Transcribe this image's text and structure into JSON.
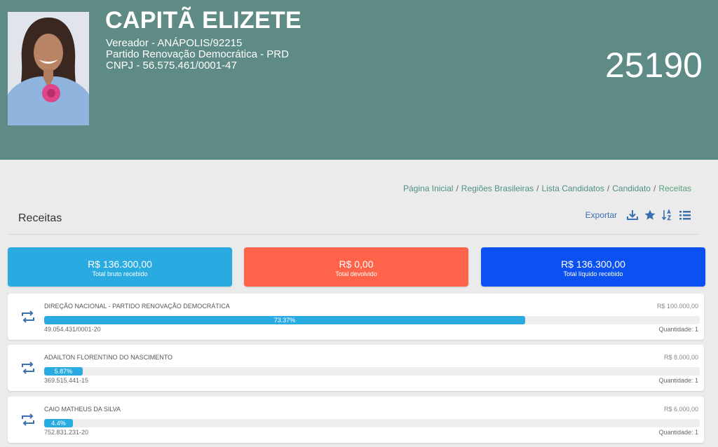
{
  "candidate": {
    "name": "CAPITÃ ELIZETE",
    "office": "Vereador - ANÁPOLIS/92215",
    "party": "Partido Renovação Democrática - PRD",
    "cnpj": "CNPJ - 56.575.461/0001-47",
    "number": "25190"
  },
  "breadcrumb": {
    "items": [
      "Página Inicial",
      "Regiões Brasileiras",
      "Lista Candidatos",
      "Candidato"
    ],
    "active": "Receitas",
    "separator": "/"
  },
  "section": {
    "title": "Receitas",
    "export_label": "Exportar",
    "icons": [
      "download-icon",
      "star-icon",
      "sort-icon",
      "list-icon"
    ]
  },
  "summary": [
    {
      "amount": "R$ 136.300,00",
      "label": "Total bruto recebido",
      "color": "#29abe2"
    },
    {
      "amount": "R$ 0,00",
      "label": "Total devolvido",
      "color": "#ff6349"
    },
    {
      "amount": "R$ 136.300,00",
      "label": "Total líquido recebido",
      "color": "#0b50f0"
    }
  ],
  "donors": [
    {
      "name": "DIREÇÃO NACIONAL - PARTIDO RENOVAÇÃO DEMOCRÁTICA",
      "amount": "R$ 100.000,00",
      "percent_label": "73.37%",
      "percent": 73.37,
      "doc": "49.054.431/0001-20",
      "quantity": "Quantidade: 1"
    },
    {
      "name": "ADAILTON FLORENTINO DO NASCIMENTO",
      "amount": "R$ 8.000,00",
      "percent_label": "5.87%",
      "percent": 5.87,
      "doc": "369.515.441-15",
      "quantity": "Quantidade: 1"
    },
    {
      "name": "CAIO MATHEUS DA SILVA",
      "amount": "R$ 6.000,00",
      "percent_label": "4.4%",
      "percent": 4.4,
      "doc": "752.831.231-20",
      "quantity": "Quantidade: 1"
    }
  ],
  "colors": {
    "header_bg": "#5e8b85",
    "progress": "#29abe2",
    "link": "#4f9085"
  }
}
